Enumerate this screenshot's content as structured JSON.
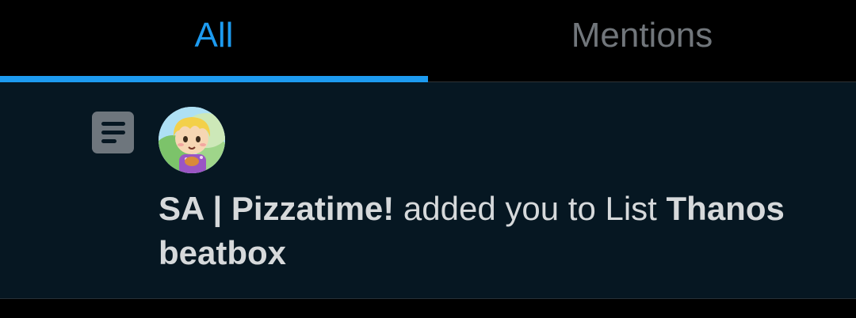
{
  "tabs": [
    {
      "label": "All",
      "active": true
    },
    {
      "label": "Mentions",
      "active": false
    }
  ],
  "colors": {
    "accent": "#1d9bf0",
    "tab_inactive": "#71767b",
    "row_background": "#061722",
    "text": "#d6d9db"
  },
  "notification": {
    "icon": "list-icon",
    "avatar": "animal-crossing-villager-avatar",
    "actor_name": "SA | Pizzatime!",
    "action_text": " added you to List ",
    "list_name": "Thanos beatbox"
  }
}
